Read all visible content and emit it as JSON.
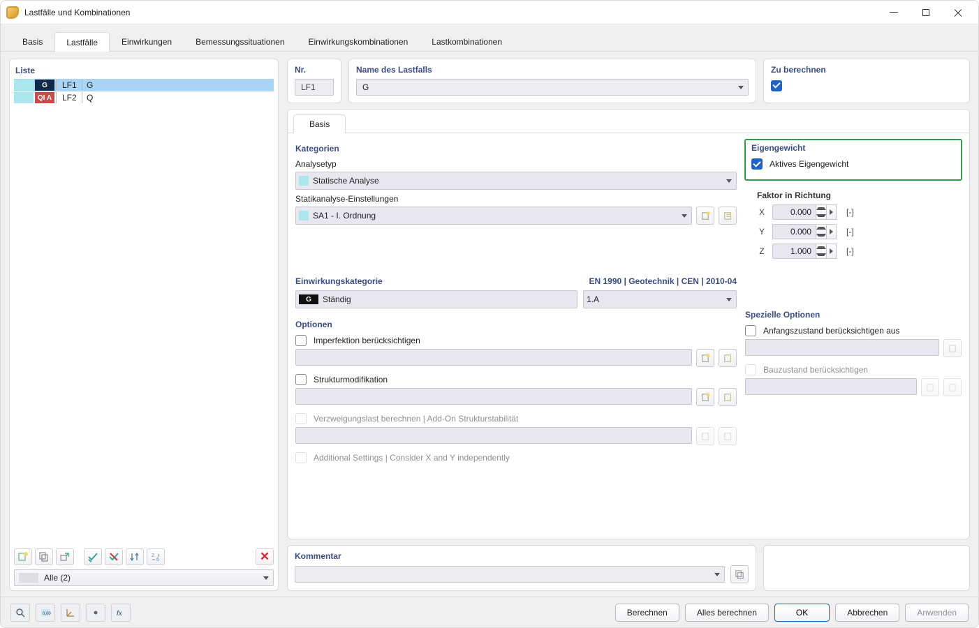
{
  "window": {
    "title": "Lastfälle und Kombinationen"
  },
  "tabs": {
    "items": [
      "Basis",
      "Lastfälle",
      "Einwirkungen",
      "Bemessungssituationen",
      "Einwirkungskombinationen",
      "Lastkombinationen"
    ],
    "active": 1
  },
  "list": {
    "heading": "Liste",
    "rows": [
      {
        "tag": "G",
        "id": "LF1",
        "name": "G",
        "selected": true,
        "swatch": "cyan",
        "tagClass": "tag-g"
      },
      {
        "tag": "QI A",
        "id": "LF2",
        "name": "Q",
        "selected": false,
        "swatch": "red",
        "tagClass": "tag-q"
      }
    ],
    "filter_label": "Alle (2)"
  },
  "detail": {
    "nr": {
      "heading": "Nr.",
      "value": "LF1"
    },
    "name": {
      "heading": "Name des Lastfalls",
      "value": "G"
    },
    "calc": {
      "heading": "Zu berechnen",
      "checked": true
    },
    "inner_tabs": {
      "items": [
        "Basis"
      ],
      "active": 0
    },
    "kategorien": {
      "heading": "Kategorien",
      "analysetyp_label": "Analysetyp",
      "analysetyp_value": "Statische Analyse",
      "statik_label": "Statikanalyse-Einstellungen",
      "statik_value": "SA1 - I. Ordnung"
    },
    "einwirkungskategorie": {
      "heading": "Einwirkungskategorie",
      "standard": "EN 1990 | Geotechnik | CEN | 2010-04",
      "value_tag": "G",
      "value_name": "Ständig",
      "value_code": "1.A"
    },
    "optionen": {
      "heading": "Optionen",
      "imperfektion": "Imperfektion berücksichtigen",
      "struktur": "Strukturmodifikation",
      "verzweigung": "Verzweigungslast berechnen | Add-On Strukturstabilität",
      "additional": "Additional Settings | Consider X and Y independently"
    },
    "eigengewicht": {
      "heading": "Eigengewicht",
      "active_label": "Aktives Eigengewicht",
      "active_checked": true,
      "faktor_heading": "Faktor in Richtung",
      "x": "0.000",
      "y": "0.000",
      "z": "1.000",
      "unit": "[-]"
    },
    "spezielle": {
      "heading": "Spezielle Optionen",
      "anfang": "Anfangszustand berücksichtigen aus",
      "bau": "Bauzustand berücksichtigen"
    },
    "kommentar": {
      "heading": "Kommentar"
    }
  },
  "footer": {
    "berechnen": "Berechnen",
    "alles": "Alles berechnen",
    "ok": "OK",
    "abbrechen": "Abbrechen",
    "anwenden": "Anwenden"
  }
}
